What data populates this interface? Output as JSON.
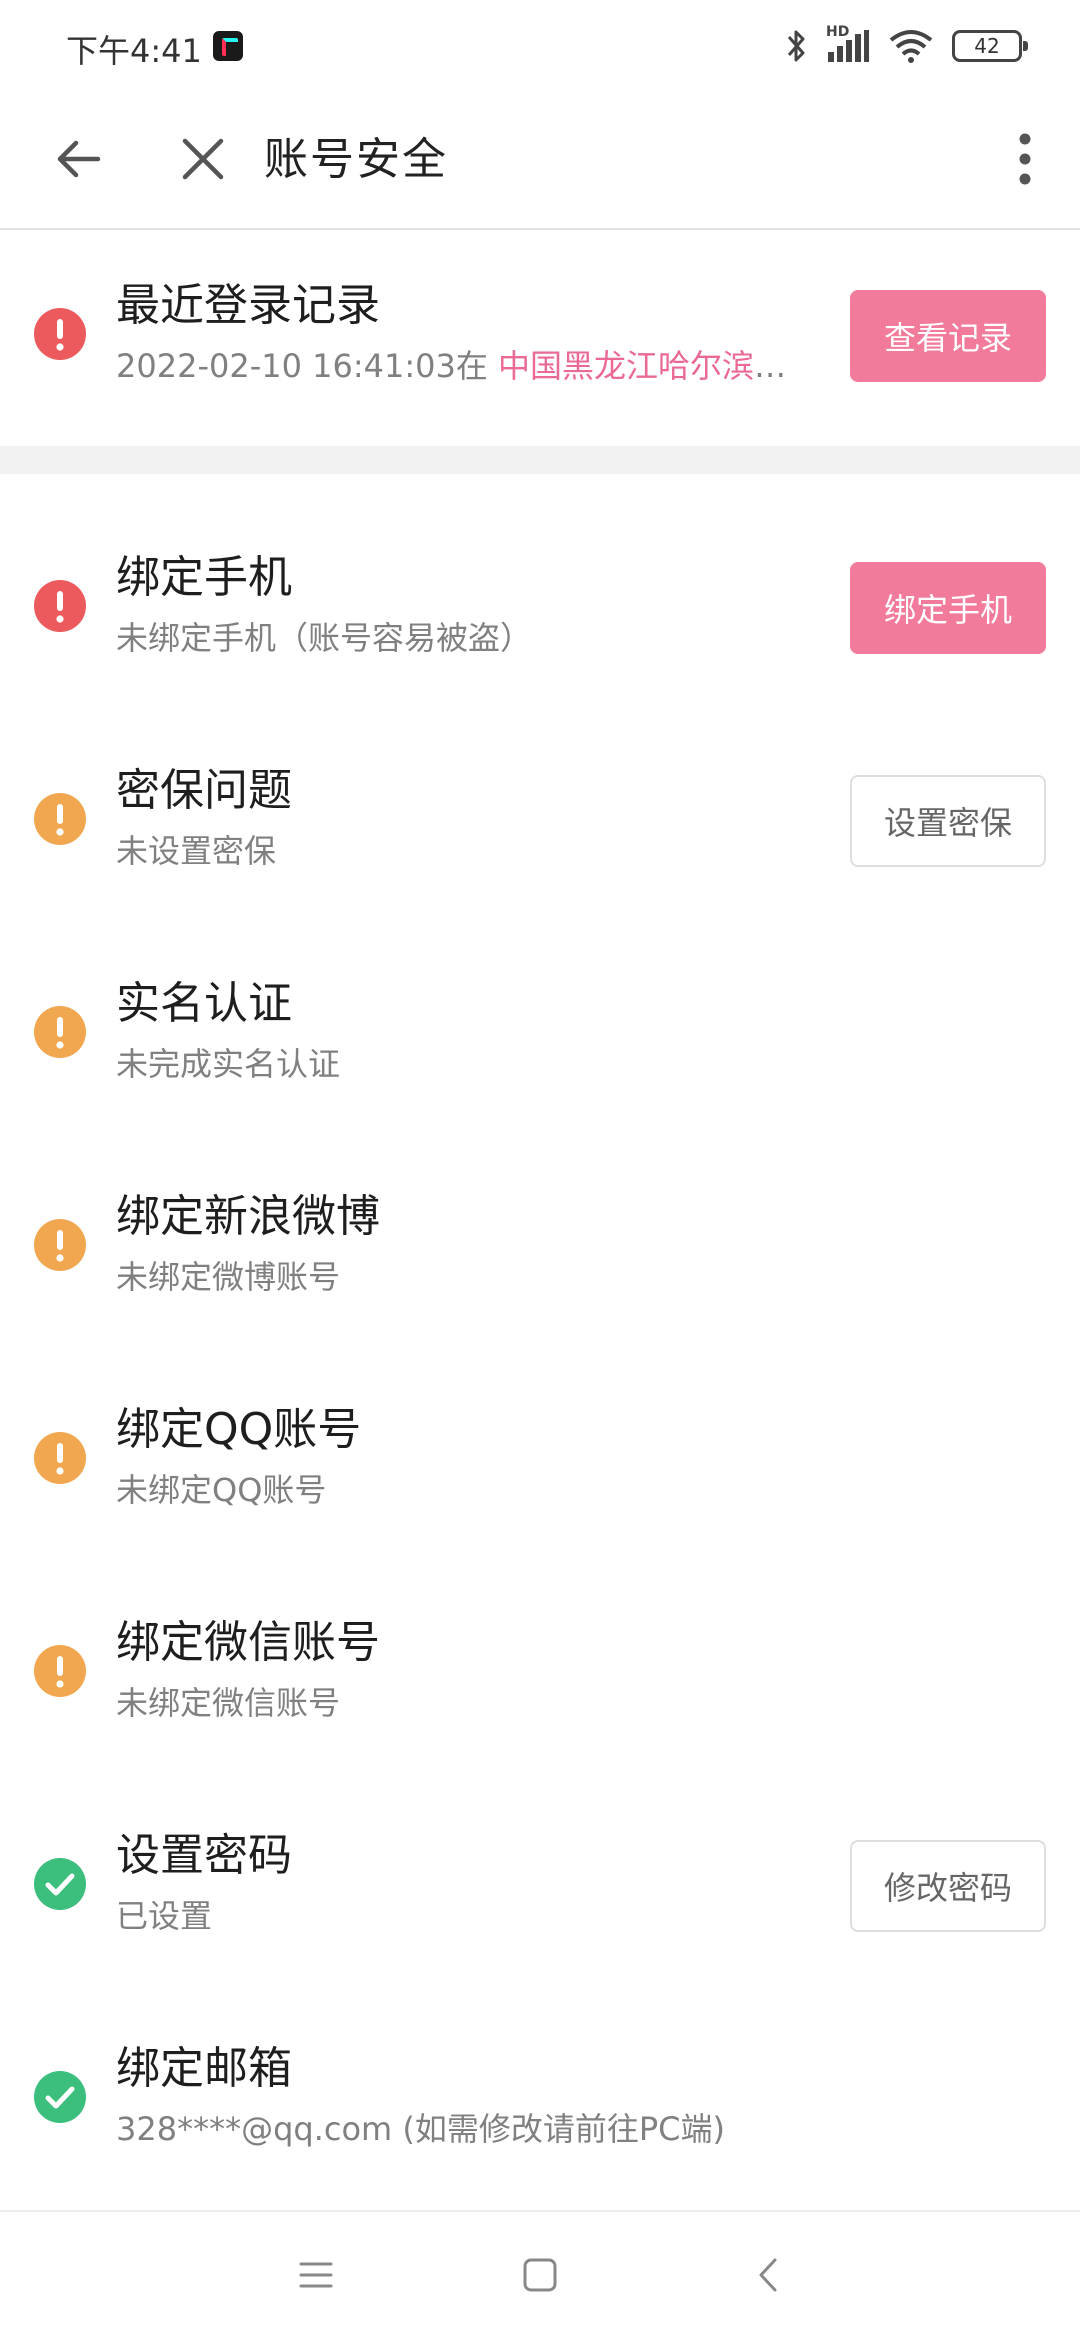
{
  "status_bar": {
    "time": "下午4:41",
    "battery_level": "42",
    "network_label": "HD"
  },
  "app_bar": {
    "title": "账号安全"
  },
  "recent_login": {
    "title": "最近登录记录",
    "datetime": "2022-02-10 16:41:03在",
    "location": "中国黑龙江哈尔滨移...",
    "button": "查看记录",
    "status": "warning-red"
  },
  "items": [
    {
      "title": "绑定手机",
      "subtitle": "未绑定手机（账号容易被盗）",
      "button": "绑定手机",
      "status": "warning-red"
    },
    {
      "title": "密保问题",
      "subtitle": "未设置密保",
      "button": "设置密保",
      "status": "warning-orange"
    },
    {
      "title": "实名认证",
      "subtitle": "未完成实名认证",
      "button": "",
      "status": "warning-orange"
    },
    {
      "title": "绑定新浪微博",
      "subtitle": "未绑定微博账号",
      "button": "",
      "status": "warning-orange"
    },
    {
      "title": "绑定QQ账号",
      "subtitle": "未绑定QQ账号",
      "button": "",
      "status": "warning-orange"
    },
    {
      "title": "绑定微信账号",
      "subtitle": "未绑定微信账号",
      "button": "",
      "status": "warning-orange"
    },
    {
      "title": "设置密码",
      "subtitle": "已设置",
      "button": "修改密码",
      "status": "ok-green"
    },
    {
      "title": "绑定邮箱",
      "subtitle": "328****@qq.com (如需修改请前往PC端)",
      "button": "",
      "status": "ok-green"
    }
  ],
  "colors": {
    "accent_pink": "#f27a9a",
    "warning_red": "#ec5a5e",
    "warning_orange": "#f1a74f",
    "ok_green": "#3cbf7c",
    "location_pink": "#ea6a93"
  },
  "icons": [
    "back-arrow-icon",
    "close-icon",
    "more-vert-icon",
    "bluetooth-icon",
    "signal-icon",
    "wifi-icon",
    "battery-icon",
    "exclamation-icon",
    "check-icon",
    "menu-lines-icon",
    "home-square-icon",
    "back-chevron-icon"
  ]
}
